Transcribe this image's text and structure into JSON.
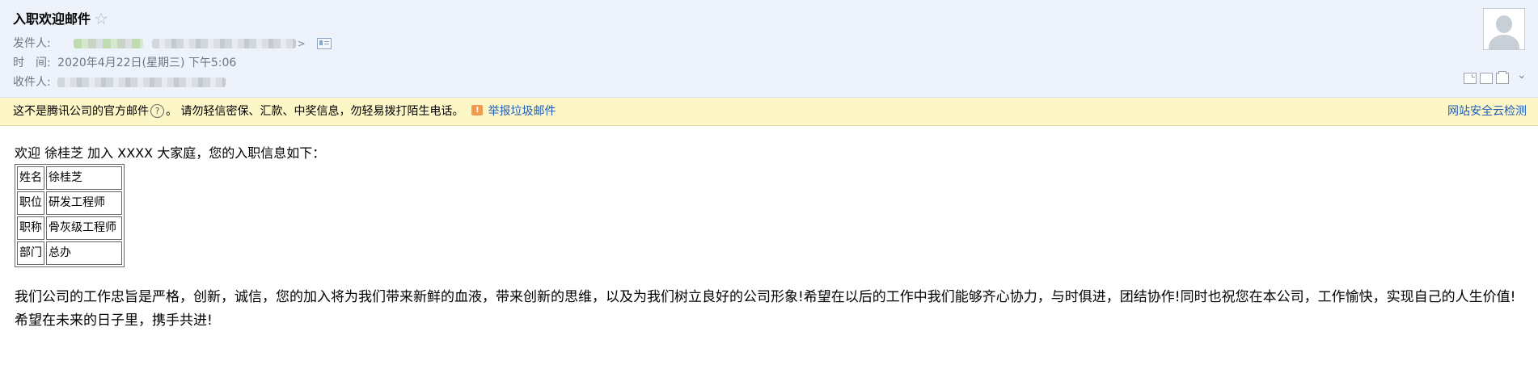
{
  "email": {
    "subject": "入职欢迎邮件",
    "star_icon": "star-outline-icon",
    "sender_label": "发件人:",
    "time_label": "时　间:",
    "time_value": "2020年4月22日(星期三) 下午5:06",
    "recipient_label": "收件人:"
  },
  "toolbar": {
    "icons": [
      "window-icon",
      "folder-icon",
      "print-icon",
      "chevron-down-icon"
    ]
  },
  "warning": {
    "notice": "这不是腾讯公司的官方邮件",
    "advice": "。 请勿轻信密保、汇款、中奖信息，勿轻易拨打陌生电话。",
    "report_link": "举报垃圾邮件",
    "security_link": "网站安全云检测"
  },
  "body": {
    "greeting": "欢迎 徐桂芝 加入 XXXX 大家庭，您的入职信息如下：",
    "info_rows": [
      {
        "key": "姓名",
        "value": "徐桂芝"
      },
      {
        "key": "职位",
        "value": "研发工程师"
      },
      {
        "key": "职称",
        "value": "骨灰级工程师"
      },
      {
        "key": "部门",
        "value": "总办"
      }
    ],
    "paragraph": "我们公司的工作忠旨是严格，创新，诚信，您的加入将为我们带来新鲜的血液，带来创新的思维，以及为我们树立良好的公司形象!希望在以后的工作中我们能够齐心协力，与时俱进，团结协作!同时也祝您在本公司，工作愉快，实现自己的人生价值!希望在未来的日子里，携手共进!"
  },
  "colors": {
    "header_bg": "#eef3fb",
    "warning_bg": "#fdf6c6",
    "link": "#1f5db8"
  }
}
